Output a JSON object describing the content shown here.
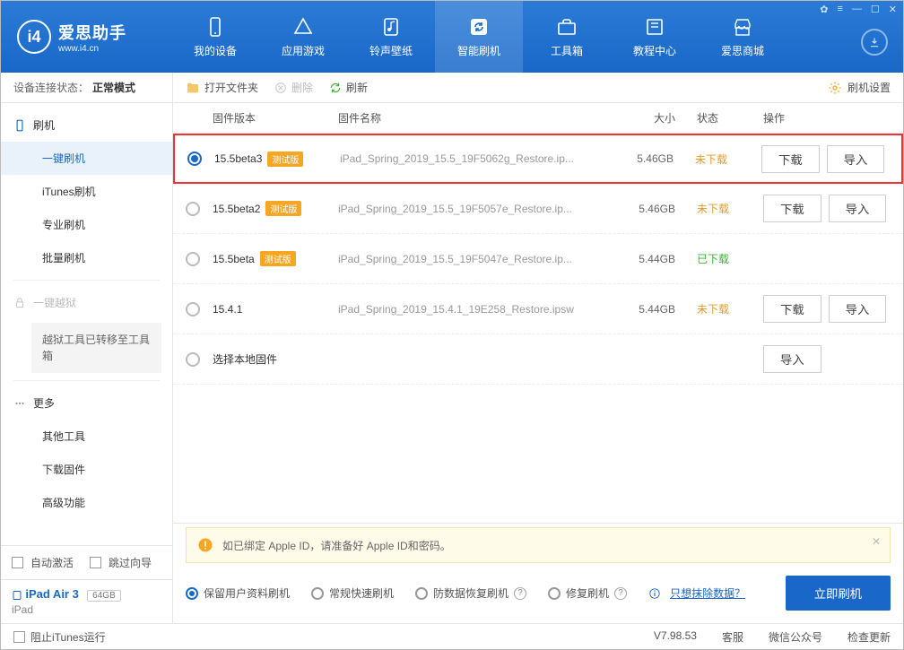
{
  "app": {
    "name": "爱思助手",
    "url": "www.i4.cn"
  },
  "nav": {
    "items": [
      {
        "label": "我的设备"
      },
      {
        "label": "应用游戏"
      },
      {
        "label": "铃声壁纸"
      },
      {
        "label": "智能刷机"
      },
      {
        "label": "工具箱"
      },
      {
        "label": "教程中心"
      },
      {
        "label": "爱思商城"
      }
    ]
  },
  "sidebar": {
    "conn_label": "设备连接状态：",
    "conn_value": "正常模式",
    "flash_head": "刷机",
    "flash_items": [
      "一键刷机",
      "iTunes刷机",
      "专业刷机",
      "批量刷机"
    ],
    "jailbreak_head": "一键越狱",
    "jailbreak_note": "越狱工具已转移至工具箱",
    "more_head": "更多",
    "more_items": [
      "其他工具",
      "下载固件",
      "高级功能"
    ],
    "auto_activate": "自动激活",
    "skip_guide": "跳过向导",
    "device_name": "iPad Air 3",
    "device_cap": "64GB",
    "device_type": "iPad"
  },
  "toolbar": {
    "open_folder": "打开文件夹",
    "delete": "删除",
    "refresh": "刷新",
    "settings": "刷机设置"
  },
  "columns": {
    "version": "固件版本",
    "name": "固件名称",
    "size": "大小",
    "status": "状态",
    "ops": "操作"
  },
  "badge_trial": "测试版",
  "btn_download": "下载",
  "btn_import": "导入",
  "status_notdl": "未下载",
  "status_done": "已下载",
  "firmwares": [
    {
      "ver": "15.5beta3",
      "beta": true,
      "name": "iPad_Spring_2019_15.5_19F5062g_Restore.ip...",
      "size": "5.46GB",
      "status": "notdl",
      "selected": true,
      "highlight": true,
      "showDl": true
    },
    {
      "ver": "15.5beta2",
      "beta": true,
      "name": "iPad_Spring_2019_15.5_19F5057e_Restore.ip...",
      "size": "5.46GB",
      "status": "notdl",
      "selected": false,
      "showDl": true
    },
    {
      "ver": "15.5beta",
      "beta": true,
      "name": "iPad_Spring_2019_15.5_19F5047e_Restore.ip...",
      "size": "5.44GB",
      "status": "done",
      "selected": false,
      "showDl": false
    },
    {
      "ver": "15.4.1",
      "beta": false,
      "name": "iPad_Spring_2019_15.4.1_19E258_Restore.ipsw",
      "size": "5.44GB",
      "status": "notdl",
      "selected": false,
      "showDl": true
    }
  ],
  "local_fw": "选择本地固件",
  "notice": "如已绑定 Apple ID，请准备好 Apple ID和密码。",
  "options": {
    "keep_data": "保留用户资料刷机",
    "normal": "常规快速刷机",
    "antiloss": "防数据恢复刷机",
    "repair": "修复刷机",
    "erase_link": "只想抹除数据？"
  },
  "flash_now": "立即刷机",
  "footer": {
    "block_itunes": "阻止iTunes运行",
    "version": "V7.98.53",
    "support": "客服",
    "wechat": "微信公众号",
    "update": "检查更新"
  }
}
